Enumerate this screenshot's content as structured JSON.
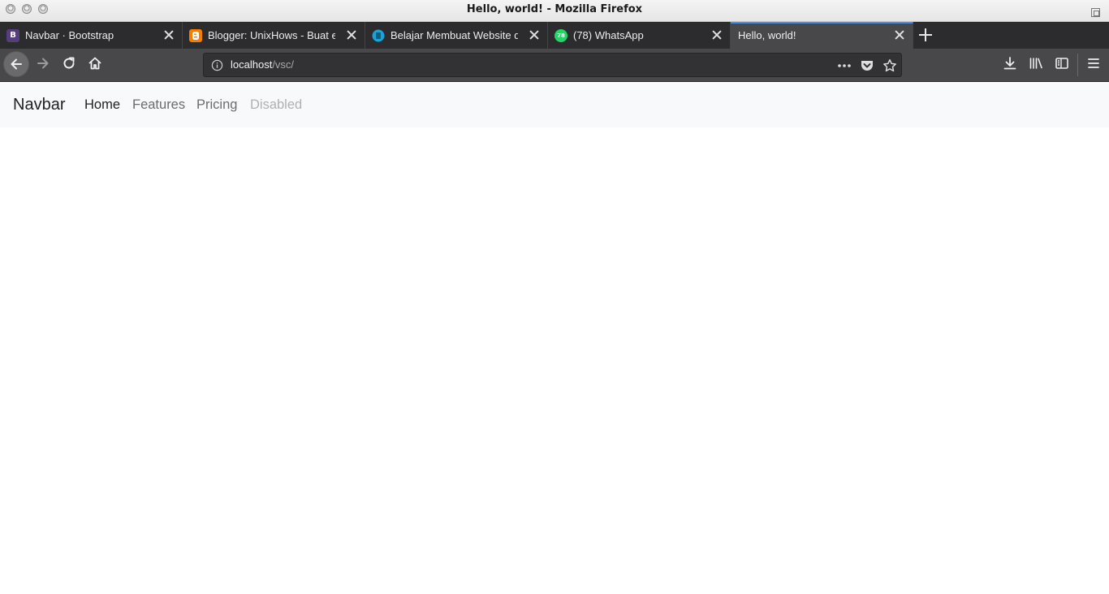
{
  "window": {
    "title": "Hello, world! - Mozilla Firefox"
  },
  "tabs": [
    {
      "label": "Navbar · Bootstrap",
      "favicon": "bootstrap-icon",
      "favicon_text": "B",
      "favicon_color": "#563d7c",
      "active": false
    },
    {
      "label": "Blogger: UnixHows - Buat e",
      "favicon": "blogger-icon",
      "favicon_color": "#f57d00",
      "active": false
    },
    {
      "label": "Belajar Membuat Website d",
      "favicon": "site-icon",
      "favicon_color": "#1aa3d9",
      "active": false
    },
    {
      "label": "(78) WhatsApp",
      "favicon": "whatsapp-icon",
      "favicon_text": "78",
      "favicon_color": "#25d366",
      "active": false
    },
    {
      "label": "Hello, world!",
      "active": true
    }
  ],
  "toolbar": {
    "url_host": "localhost",
    "url_path": "/vsc/",
    "icons": [
      "back-icon",
      "forward-icon",
      "reload-icon",
      "home-icon",
      "info-icon",
      "page-actions-icon",
      "pocket-icon",
      "bookmark-star-icon",
      "downloads-icon",
      "library-icon",
      "sidebar-icon",
      "menu-icon"
    ]
  },
  "page": {
    "navbar": {
      "brand": "Navbar",
      "links": [
        {
          "label": "Home",
          "state": "active"
        },
        {
          "label": "Features",
          "state": "normal"
        },
        {
          "label": "Pricing",
          "state": "normal"
        },
        {
          "label": "Disabled",
          "state": "disabled"
        }
      ]
    }
  },
  "colors": {
    "tab_accent": "#4a90e2",
    "link_active": "#212121",
    "link_normal": "#6c6c6c",
    "link_disabled": "#b0b0b0",
    "navbar_bg": "#f8f9fa"
  }
}
